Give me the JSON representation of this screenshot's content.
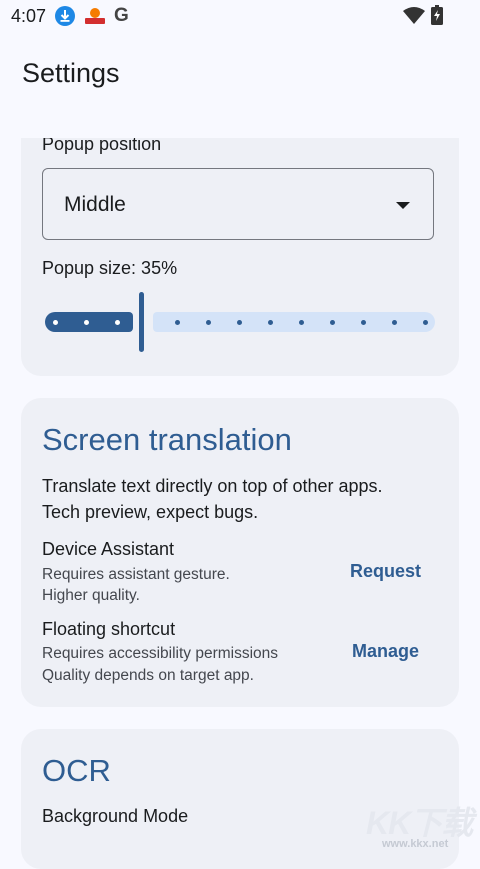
{
  "status_bar": {
    "time": "4:07",
    "icons": [
      "download-icon",
      "app-notification-icon",
      "google-icon",
      "wifi-icon",
      "battery-charging-icon"
    ],
    "google_letter": "G"
  },
  "header": {
    "title": "Settings"
  },
  "popup_card": {
    "position_label": "Popup position",
    "position_value": "Middle",
    "size_label": "Popup size: 35%",
    "size_fraction": 0.35
  },
  "screen_translation": {
    "title": "Screen translation",
    "description_1": "Translate text directly on top of other apps.",
    "description_2": "Tech preview, expect bugs.",
    "device_assistant": {
      "title": "Device Assistant",
      "line1": "Requires assistant gesture.",
      "line2": "Higher quality.",
      "action": "Request"
    },
    "floating_shortcut": {
      "title": "Floating shortcut",
      "line1": "Requires accessibility permissions",
      "line2": "Quality depends on target app.",
      "action": "Manage"
    }
  },
  "ocr": {
    "title": "OCR",
    "background_mode": "Background Mode"
  },
  "watermark": {
    "big": "KK下载",
    "small": "www.kkx.net"
  },
  "colors": {
    "accent": "#2f5d92",
    "track_inactive": "#d4e3f8",
    "card": "#eef0f6",
    "background": "#f8f9ff"
  }
}
